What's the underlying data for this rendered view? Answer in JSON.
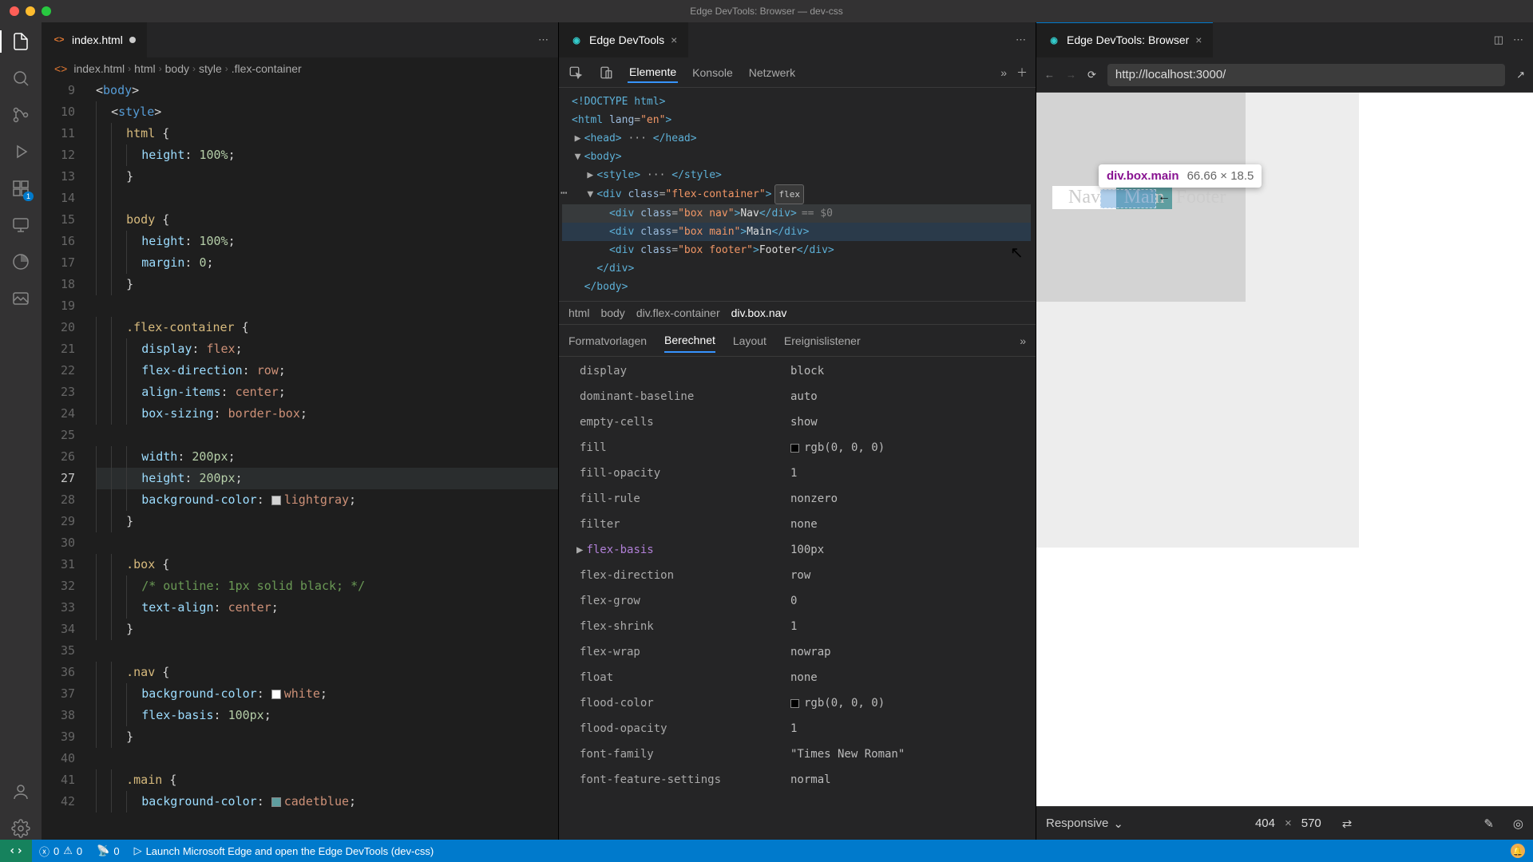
{
  "window_title": "Edge DevTools: Browser — dev-css",
  "editor_tab": {
    "file": "index.html",
    "dirty": true
  },
  "devtools_tab": "Edge DevTools",
  "browser_tab": "Edge DevTools: Browser",
  "breadcrumb": {
    "file": "index.html",
    "path": [
      "html",
      "body",
      "style",
      ".flex-container"
    ]
  },
  "devtools_tabs": [
    "Elemente",
    "Konsole",
    "Netzwerk"
  ],
  "devtools_tabs_active": "Elemente",
  "styles_tabs": [
    "Formatvorlagen",
    "Berechnet",
    "Layout",
    "Ereignislistener"
  ],
  "styles_tabs_active": "Berechnet",
  "dom_crumb": [
    "html",
    "body",
    "div.flex-container",
    "div.box.nav"
  ],
  "url": "http://localhost:3000/",
  "hl_tooltip": {
    "selector": "div.box.main",
    "dims": "66.66 × 18.5"
  },
  "page_boxes": {
    "nav": "Nav",
    "main": "Main",
    "footer": "Footer"
  },
  "device": {
    "name": "Responsive",
    "w": "404",
    "h": "570"
  },
  "status": {
    "errors": "0",
    "warnings": "0",
    "port": "0",
    "launch": "Launch Microsoft Edge and open the Edge DevTools (dev-css)"
  },
  "code_lines": [
    {
      "n": 9,
      "html": "<span class='t-pn'>&lt;</span><span class='t-tag'>body</span><span class='t-pn'>&gt;</span>"
    },
    {
      "n": 10,
      "html": "  <span class='t-pn'>&lt;</span><span class='t-tag'>style</span><span class='t-pn'>&gt;</span>"
    },
    {
      "n": 11,
      "html": "    <span class='t-sel'>html</span> <span class='t-pn'>{</span>"
    },
    {
      "n": 12,
      "html": "      <span class='t-prop'>height</span><span class='t-pn'>: </span><span class='t-num'>100%</span><span class='t-pn'>;</span>"
    },
    {
      "n": 13,
      "html": "    <span class='t-pn'>}</span>"
    },
    {
      "n": 14,
      "html": "    "
    },
    {
      "n": 15,
      "html": "    <span class='t-sel'>body</span> <span class='t-pn'>{</span>"
    },
    {
      "n": 16,
      "html": "      <span class='t-prop'>height</span><span class='t-pn'>: </span><span class='t-num'>100%</span><span class='t-pn'>;</span>"
    },
    {
      "n": 17,
      "html": "      <span class='t-prop'>margin</span><span class='t-pn'>: </span><span class='t-num'>0</span><span class='t-pn'>;</span>"
    },
    {
      "n": 18,
      "html": "    <span class='t-pn'>}</span>"
    },
    {
      "n": 19,
      "html": ""
    },
    {
      "n": 20,
      "html": "    <span class='t-sel'>.flex-container</span> <span class='t-pn'>{</span>"
    },
    {
      "n": 21,
      "html": "      <span class='t-prop'>display</span><span class='t-pn'>: </span><span class='t-val'>flex</span><span class='t-pn'>;</span>"
    },
    {
      "n": 22,
      "html": "      <span class='t-prop'>flex-direction</span><span class='t-pn'>: </span><span class='t-val'>row</span><span class='t-pn'>;</span>"
    },
    {
      "n": 23,
      "html": "      <span class='t-prop'>align-items</span><span class='t-pn'>: </span><span class='t-val'>center</span><span class='t-pn'>;</span>"
    },
    {
      "n": 24,
      "html": "      <span class='t-prop'>box-sizing</span><span class='t-pn'>: </span><span class='t-val'>border-box</span><span class='t-pn'>;</span>"
    },
    {
      "n": 25,
      "html": ""
    },
    {
      "n": 26,
      "html": "      <span class='t-prop'>width</span><span class='t-pn'>: </span><span class='t-num'>200px</span><span class='t-pn'>;</span>"
    },
    {
      "n": 27,
      "hl": true,
      "html": "      <span class='t-prop'>height</span><span class='t-pn'>: </span><span class='t-num'>200px</span><span class='t-pn'>;</span>"
    },
    {
      "n": 28,
      "html": "      <span class='t-prop'>background-color</span><span class='t-pn'>: </span><span class='swatch' style='background:#d3d3d3'></span><span class='t-val'>lightgray</span><span class='t-pn'>;</span>"
    },
    {
      "n": 29,
      "html": "    <span class='t-pn'>}</span>"
    },
    {
      "n": 30,
      "html": ""
    },
    {
      "n": 31,
      "html": "    <span class='t-sel'>.box</span> <span class='t-pn'>{</span>"
    },
    {
      "n": 32,
      "html": "      <span class='t-cmt'>/* outline: 1px solid black; */</span>"
    },
    {
      "n": 33,
      "html": "      <span class='t-prop'>text-align</span><span class='t-pn'>: </span><span class='t-val'>center</span><span class='t-pn'>;</span>"
    },
    {
      "n": 34,
      "html": "    <span class='t-pn'>}</span>"
    },
    {
      "n": 35,
      "html": ""
    },
    {
      "n": 36,
      "html": "    <span class='t-sel'>.nav</span> <span class='t-pn'>{</span>"
    },
    {
      "n": 37,
      "html": "      <span class='t-prop'>background-color</span><span class='t-pn'>: </span><span class='swatch' style='background:#fff'></span><span class='t-val'>white</span><span class='t-pn'>;</span>"
    },
    {
      "n": 38,
      "html": "      <span class='t-prop'>flex-basis</span><span class='t-pn'>: </span><span class='t-num'>100px</span><span class='t-pn'>;</span>"
    },
    {
      "n": 39,
      "html": "    <span class='t-pn'>}</span>"
    },
    {
      "n": 40,
      "html": ""
    },
    {
      "n": 41,
      "html": "    <span class='t-sel'>.main</span> <span class='t-pn'>{</span>"
    },
    {
      "n": 42,
      "html": "      <span class='t-prop'>background-color</span><span class='t-pn'>: </span><span class='swatch' style='background:#5f9ea0'></span><span class='t-val'>cadetblue</span><span class='t-pn'>;</span>"
    }
  ],
  "elements_tree": [
    {
      "ind": 0,
      "html": "<span class='tag'>&lt;!DOCTYPE html&gt;</span>"
    },
    {
      "ind": 0,
      "html": "<span class='tag'>&lt;html</span> <span class='an'>lang</span>=<span class='av'>\"en\"</span><span class='tag'>&gt;</span>"
    },
    {
      "ind": 1,
      "caret": "▶",
      "html": "<span class='tag'>&lt;head&gt;</span> ··· <span class='tag'>&lt;/head&gt;</span>"
    },
    {
      "ind": 1,
      "caret": "▼",
      "html": "<span class='tag'>&lt;body&gt;</span>"
    },
    {
      "ind": 2,
      "caret": "▶",
      "html": "<span class='tag'>&lt;style&gt;</span> ··· <span class='tag'>&lt;/style&gt;</span>"
    },
    {
      "ind": 2,
      "caret": "▼",
      "html": "<span class='tag'>&lt;div</span> <span class='an'>class</span>=<span class='av'>\"flex-container\"</span><span class='tag'>&gt;</span><span class='flex-badge'>flex</span>",
      "ell": true
    },
    {
      "ind": 3,
      "sel": true,
      "html": "<span class='tag'>&lt;div</span> <span class='an'>class</span>=<span class='av'>\"box nav\"</span><span class='tag'>&gt;</span><span class='tx'>Nav</span><span class='tag'>&lt;/div&gt;</span><span class='eqsel'>== $0</span>"
    },
    {
      "ind": 3,
      "hov": true,
      "html": "<span class='tag'>&lt;div</span> <span class='an'>class</span>=<span class='av'>\"box main\"</span><span class='tag'>&gt;</span><span class='tx'>Main</span><span class='tag'>&lt;/div&gt;</span>"
    },
    {
      "ind": 3,
      "html": "<span class='tag'>&lt;div</span> <span class='an'>class</span>=<span class='av'>\"box footer\"</span><span class='tag'>&gt;</span><span class='tx'>Footer</span><span class='tag'>&lt;/div&gt;</span>"
    },
    {
      "ind": 2,
      "html": "<span class='tag'>&lt;/div&gt;</span>"
    },
    {
      "ind": 1,
      "html": "<span class='tag'>&lt;/body&gt;</span>"
    }
  ],
  "computed": [
    {
      "p": "display",
      "v": "block"
    },
    {
      "p": "dominant-baseline",
      "v": "auto"
    },
    {
      "p": "empty-cells",
      "v": "show"
    },
    {
      "p": "fill",
      "v": "rgb(0, 0, 0)",
      "c": "#000"
    },
    {
      "p": "fill-opacity",
      "v": "1"
    },
    {
      "p": "fill-rule",
      "v": "nonzero"
    },
    {
      "p": "filter",
      "v": "none"
    },
    {
      "p": "flex-basis",
      "v": "100px",
      "set": true,
      "tri": true
    },
    {
      "p": "flex-direction",
      "v": "row"
    },
    {
      "p": "flex-grow",
      "v": "0"
    },
    {
      "p": "flex-shrink",
      "v": "1"
    },
    {
      "p": "flex-wrap",
      "v": "nowrap"
    },
    {
      "p": "float",
      "v": "none"
    },
    {
      "p": "flood-color",
      "v": "rgb(0, 0, 0)",
      "c": "#000"
    },
    {
      "p": "flood-opacity",
      "v": "1"
    },
    {
      "p": "font-family",
      "v": "\"Times New Roman\""
    },
    {
      "p": "font-feature-settings",
      "v": "normal"
    }
  ]
}
